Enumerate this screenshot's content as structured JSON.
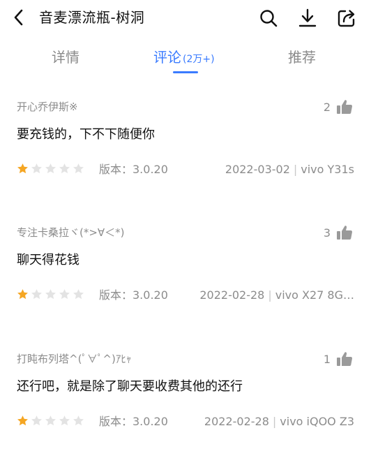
{
  "header": {
    "title": "音麦漂流瓶-树洞",
    "back_icon": "chevron-left-icon",
    "actions": [
      "search-icon",
      "download-icon",
      "share-icon"
    ]
  },
  "tabs": [
    {
      "label": "详情",
      "count": "",
      "active": false
    },
    {
      "label": "评论",
      "count": "(2万+)",
      "active": true
    },
    {
      "label": "推荐",
      "count": "",
      "active": false
    }
  ],
  "accent_color": "#3a7bff",
  "star_color": "#f5a623",
  "reviews": [
    {
      "user": "开心乔伊斯※",
      "likes": "2",
      "text": "要充钱的，下不下随便你",
      "rating": 1,
      "rating_max": 5,
      "version": "版本：3.0.20",
      "date": "2022-03-02",
      "device": "vivo Y31s"
    },
    {
      "user": "专注卡桑拉ヾ(*>∀＜*)",
      "likes": "3",
      "text": "聊天得花钱",
      "rating": 1,
      "rating_max": 5,
      "version": "版本：3.0.20",
      "date": "2022-02-28",
      "device": "vivo X27 8G…"
    },
    {
      "user": "打盹布列塔^(ﾟ∀ﾟ^)ｱﾋｬ",
      "likes": "1",
      "text": "还行吧，就是除了聊天要收费其他的还行",
      "rating": 1,
      "rating_max": 5,
      "version": "版本：3.0.20",
      "date": "2022-02-28",
      "device": "vivo iQOO Z3"
    }
  ]
}
